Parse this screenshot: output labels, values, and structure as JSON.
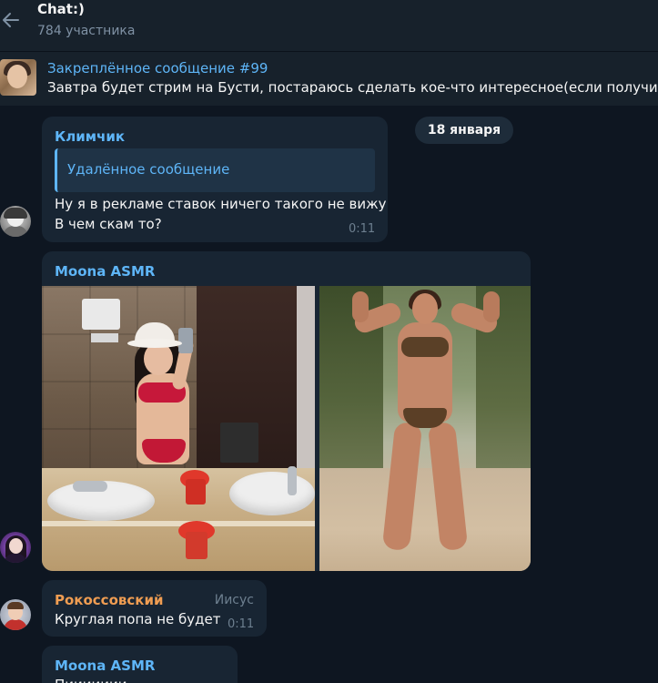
{
  "header": {
    "title": "Chat:)",
    "subtitle": "784 участника"
  },
  "pinned": {
    "title": "Закреплённое сообщение #99",
    "text": "Завтра будет стрим на Бусти, постараюсь сделать кое-что интересное(если получится"
  },
  "date_separator": "18 января",
  "messages": [
    {
      "sender": "Климчик",
      "reply": "Удалённое сообщение",
      "lines": [
        "Ну я в рекламе ставок ничего такого не вижу",
        "В чем скам то?"
      ],
      "time": "0:11"
    },
    {
      "sender": "Moona ASMR",
      "photos": [
        "mirror selfie in bathroom",
        "bodybuilder posing outdoors"
      ]
    },
    {
      "sender": "Рокоссовский",
      "admin_tag": "Иисус",
      "lines": [
        "Круглая попа не будет"
      ],
      "time": "0:11"
    },
    {
      "sender": "Moona ASMR",
      "lines": [
        "Пиииииии..."
      ]
    }
  ],
  "colors": {
    "background": "#0e1621",
    "panel": "#17212b",
    "bubble": "#182533",
    "accent_blue": "#5eb5f7",
    "accent_orange": "#f09d52",
    "muted": "#6d7f8f"
  }
}
